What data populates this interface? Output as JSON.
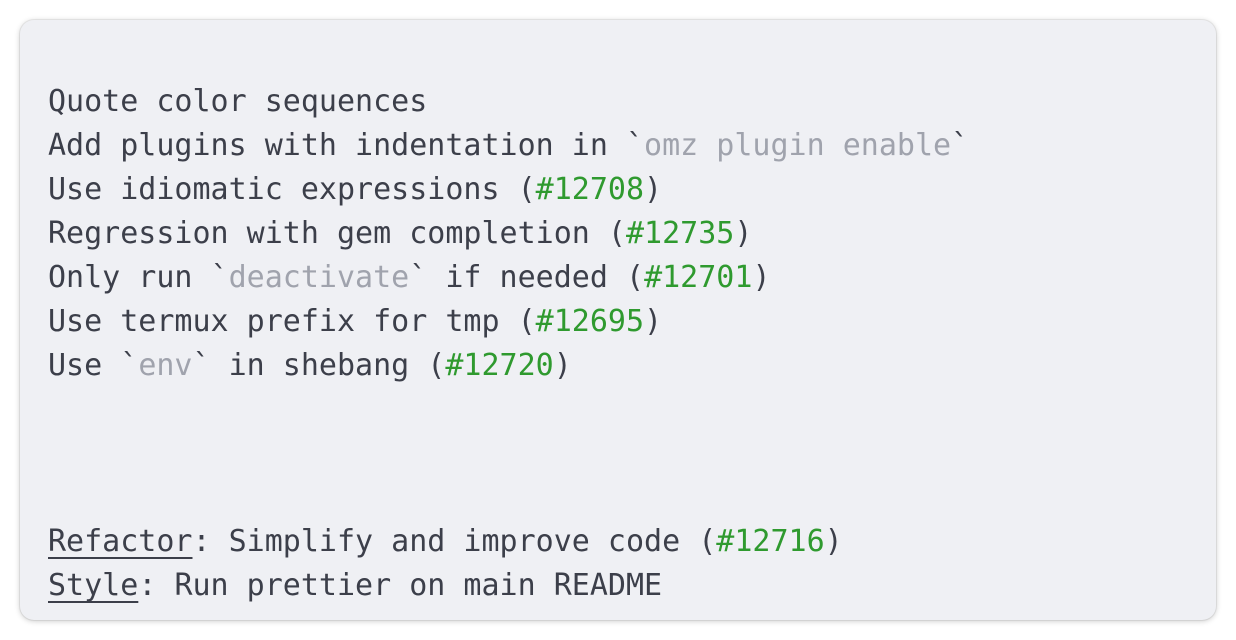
{
  "lines": [
    {
      "text": "Quote color sequences"
    },
    {
      "pre": "Add plugins with indentation in ",
      "tick_open": "`",
      "code": "omz plugin enable",
      "tick_close": "`"
    },
    {
      "pre": "Use idiomatic expressions (",
      "pr": "#12708",
      "post": ")"
    },
    {
      "pre": "Regression with gem completion (",
      "pr": "#12735",
      "post": ")"
    },
    {
      "pre": "Only run ",
      "tick_open": "`",
      "code": "deactivate",
      "tick_close": "`",
      "mid": " if needed (",
      "pr": "#12701",
      "post": ")"
    },
    {
      "pre": "Use termux prefix for tmp (",
      "pr": "#12695",
      "post": ")"
    },
    {
      "pre": "Use ",
      "tick_open": "`",
      "code": "env",
      "tick_close": "`",
      "mid": " in shebang (",
      "pr": "#12720",
      "post": ")"
    }
  ],
  "footer": [
    {
      "tag": "Refactor",
      "sep": ": ",
      "pre": "Simplify and improve code (",
      "pr": "#12716",
      "post": ")"
    },
    {
      "tag": "Style",
      "sep": ": ",
      "text": "Run prettier on main README"
    }
  ],
  "colors": {
    "background": "#eff0f4",
    "text": "#3c3f4a",
    "code": "#a0a3ad",
    "pr_link": "#2f9a2f"
  }
}
